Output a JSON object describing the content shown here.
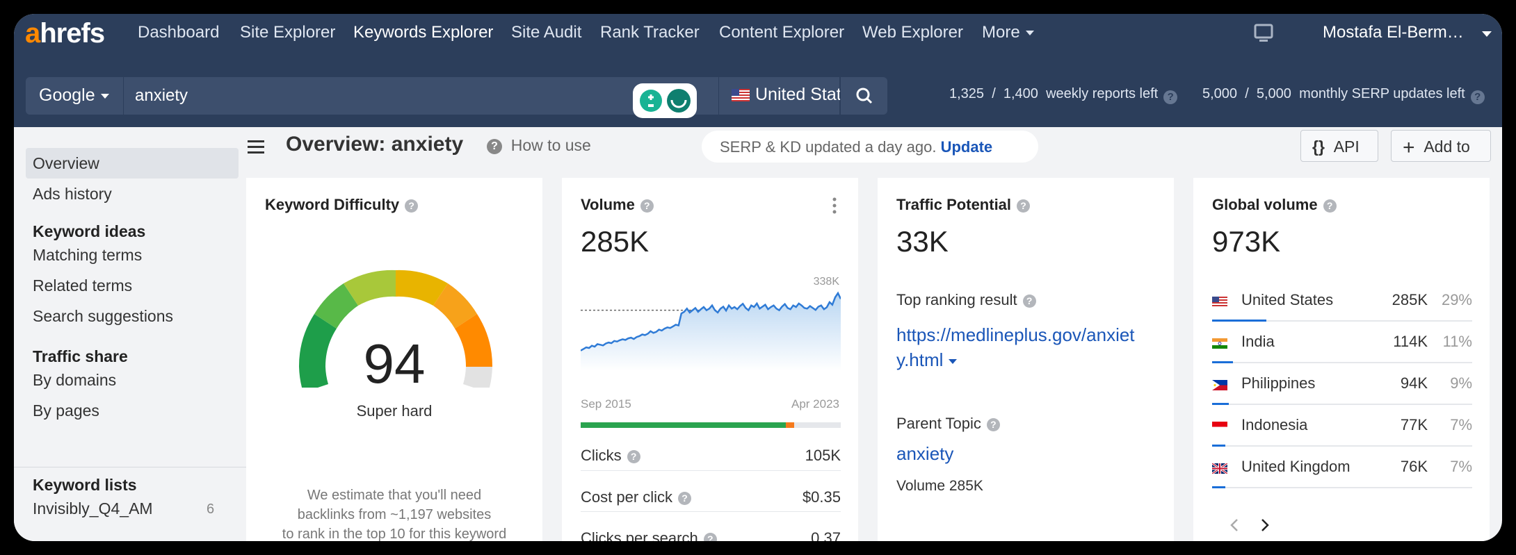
{
  "app": {
    "logo_a": "a",
    "logo_rest": "hrefs"
  },
  "nav": {
    "items": [
      {
        "label": "Dashboard"
      },
      {
        "label": "Site Explorer"
      },
      {
        "label": "Keywords Explorer"
      },
      {
        "label": "Site Audit"
      },
      {
        "label": "Rank Tracker"
      },
      {
        "label": "Content Explorer"
      },
      {
        "label": "Web Explorer"
      },
      {
        "label": "More"
      }
    ],
    "active": "Keywords Explorer",
    "user": "Mostafa El-Berm…"
  },
  "search": {
    "engine": "Google",
    "query": "anxiety",
    "country": "United States",
    "weekly_used": "1,325",
    "weekly_total": "1,400",
    "weekly_label": "weekly reports left",
    "monthly_used": "5,000",
    "monthly_total": "5,000",
    "monthly_label": "monthly SERP updates left",
    "sep": "/"
  },
  "sidebar": {
    "overview": "Overview",
    "ads_history": "Ads history",
    "keyword_ideas_head": "Keyword ideas",
    "matching_terms": "Matching terms",
    "related_terms": "Related terms",
    "search_suggestions": "Search suggestions",
    "traffic_share_head": "Traffic share",
    "by_domains": "By domains",
    "by_pages": "By pages",
    "keyword_lists_head": "Keyword lists",
    "list_name": "Invisibly_Q4_AM",
    "list_count": "6"
  },
  "header": {
    "title": "Overview: anxiety",
    "how_to_use": "How to use",
    "serp_status": "SERP & KD updated a day ago.",
    "update_link": "Update",
    "api_label": "API",
    "api_glyph": "{}",
    "add_to_label": "Add to",
    "add_glyph": "+"
  },
  "kd": {
    "title": "Keyword Difficulty",
    "value": "94",
    "label": "Super hard",
    "score": 94,
    "estimate": [
      "We estimate that you'll need",
      "backlinks from ~1,197 websites",
      "to rank in the top 10 for this keyword"
    ]
  },
  "volume": {
    "title": "Volume",
    "value": "285K",
    "chart_max_label": "338K",
    "start_label": "Sep 2015",
    "end_label": "Apr 2023",
    "clicks_label": "Clicks",
    "clicks": "105K",
    "cpc_label": "Cost per click",
    "cpc": "$0.35",
    "cps_label": "Clicks per search",
    "cps": "0.37",
    "click_split": {
      "organic": 0.79,
      "paid": 0.03
    }
  },
  "traffic": {
    "title": "Traffic Potential",
    "value": "33K",
    "top_result_label": "Top ranking result",
    "top_result_url_1": "https://medlineplus.gov/anxiet",
    "top_result_url_2": "y.html",
    "parent_topic_label": "Parent Topic",
    "parent_topic": "anxiety",
    "parent_volume": "Volume 285K"
  },
  "global": {
    "title": "Global volume",
    "value": "973K",
    "countries": [
      {
        "name": "United States",
        "volume": "285K",
        "pct": "29%",
        "share": 0.29,
        "flag": "us"
      },
      {
        "name": "India",
        "volume": "114K",
        "pct": "11%",
        "share": 0.11,
        "flag": "in"
      },
      {
        "name": "Philippines",
        "volume": "94K",
        "pct": "9%",
        "share": 0.09,
        "flag": "ph"
      },
      {
        "name": "Indonesia",
        "volume": "77K",
        "pct": "7%",
        "share": 0.07,
        "flag": "id"
      },
      {
        "name": "United Kingdom",
        "volume": "76K",
        "pct": "7%",
        "share": 0.07,
        "flag": "gb"
      }
    ]
  },
  "chart_data": {
    "type": "area",
    "xlabel": "",
    "ylabel": "",
    "x_range": [
      "Sep 2015",
      "Apr 2023"
    ],
    "ylim": [
      0,
      338000
    ],
    "reference_line": 285000,
    "values": [
      160000,
      165000,
      170000,
      168000,
      175000,
      172000,
      180000,
      178000,
      176000,
      182000,
      185000,
      183000,
      190000,
      188000,
      192000,
      195000,
      193000,
      198000,
      200000,
      196000,
      202000,
      205000,
      210000,
      208000,
      212000,
      220000,
      215000,
      218000,
      225000,
      222000,
      228000,
      232000,
      230000,
      235000,
      240000,
      238000,
      275000,
      280000,
      290000,
      278000,
      285000,
      292000,
      280000,
      288000,
      295000,
      285000,
      290000,
      300000,
      285000,
      278000,
      290000,
      296000,
      284000,
      300000,
      290000,
      295000,
      288000,
      298000,
      305000,
      292000,
      285000,
      300000,
      295000,
      306000,
      290000,
      296000,
      302000,
      288000,
      295000,
      300000,
      290000,
      285000,
      296000,
      304000,
      292000,
      288000,
      300000,
      295000,
      306000,
      300000,
      292000,
      290000,
      298000,
      292000,
      286000,
      296000,
      300000,
      288000,
      294000,
      310000,
      302000,
      325000,
      338000,
      320000
    ]
  }
}
